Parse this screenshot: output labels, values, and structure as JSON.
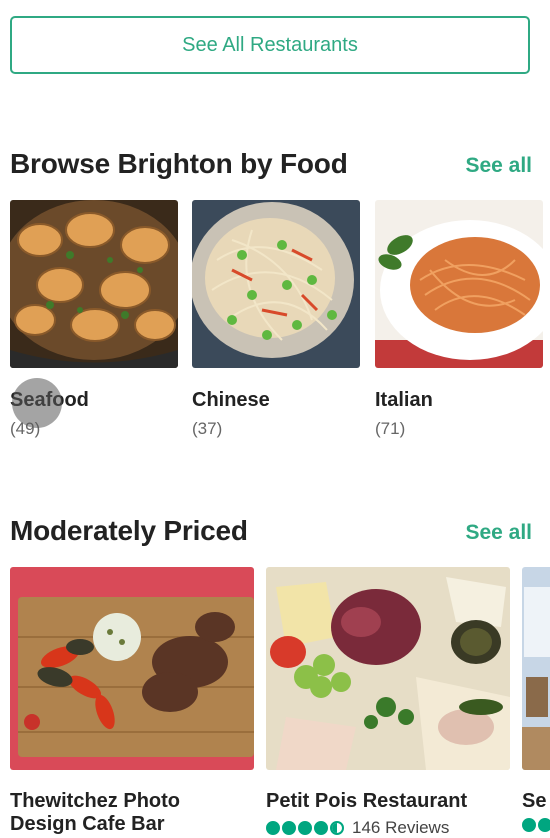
{
  "top_button": {
    "label": "See All Restaurants"
  },
  "food_section": {
    "title": "Browse Brighton by Food",
    "see_all": "See all",
    "items": [
      {
        "name": "Seafood",
        "count": "(49)"
      },
      {
        "name": "Chinese",
        "count": "(37)"
      },
      {
        "name": "Italian",
        "count": "(71)"
      }
    ]
  },
  "price_section": {
    "title": "Moderately Priced",
    "see_all": "See all",
    "restaurants": [
      {
        "name_line1": "Thewitchez Photo",
        "name_line2": "Design Cafe Bar"
      },
      {
        "name": "Petit Pois Restaurant",
        "rating": 4.5,
        "reviews": "146 Reviews"
      },
      {
        "name": "Se"
      }
    ]
  },
  "colors": {
    "accent": "#2fa983",
    "rating": "#00a680"
  }
}
